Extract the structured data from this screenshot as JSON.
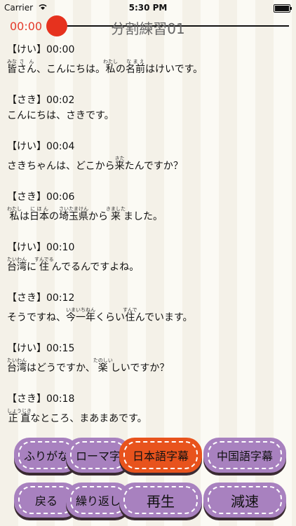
{
  "status": {
    "carrier": "Carrier",
    "time": "5:30 PM"
  },
  "player": {
    "elapsed": "00:00",
    "title": "分割練習01",
    "progress": 0
  },
  "transcript": [
    {
      "speaker": "【けい】00:00",
      "segments": [
        {
          "t": "皆",
          "r": "みな"
        },
        {
          "t": "さん",
          "r": "さん"
        },
        {
          "t": "、こんにちは。"
        },
        {
          "t": "私",
          "r": "わたし"
        },
        {
          "t": "の"
        },
        {
          "t": "名前",
          "r": "なまえ"
        },
        {
          "t": "はけいです。"
        }
      ]
    },
    {
      "speaker": "【さき】00:02",
      "segments": [
        {
          "t": "こんにちは、さきです。"
        }
      ]
    },
    {
      "speaker": "【けい】00:04",
      "segments": [
        {
          "t": "さきちゃんは、どこから"
        },
        {
          "t": "来",
          "r": "きた"
        },
        {
          "t": "たんですか？"
        }
      ]
    },
    {
      "speaker": "【さき】00:06",
      "segments": [
        {
          "t": "私",
          "r": "わたし"
        },
        {
          "t": "は"
        },
        {
          "t": "日本",
          "r": "にほん"
        },
        {
          "t": "の"
        },
        {
          "t": "埼玉県",
          "r": "さいたまけん"
        },
        {
          "t": "から"
        },
        {
          "t": "来",
          "r": "きました"
        },
        {
          "t": "ました。"
        }
      ]
    },
    {
      "speaker": "【けい】00:10",
      "segments": [
        {
          "t": "台湾",
          "r": "たいわん"
        },
        {
          "t": "に"
        },
        {
          "t": "住",
          "r": "すんでる"
        },
        {
          "t": "んでるんですよね。"
        }
      ]
    },
    {
      "speaker": "【さき】00:12",
      "segments": [
        {
          "t": "そうですね、"
        },
        {
          "t": "今一年",
          "r": "いまいちねん"
        },
        {
          "t": "くらい"
        },
        {
          "t": "住",
          "r": "すんで"
        },
        {
          "t": "んでいます。"
        }
      ]
    },
    {
      "speaker": "【けい】00:15",
      "segments": [
        {
          "t": "台湾",
          "r": "たいわん"
        },
        {
          "t": "はどうですか、"
        },
        {
          "t": "楽",
          "r": "たのしい"
        },
        {
          "t": "しいですか？"
        }
      ]
    },
    {
      "speaker": "【さき】00:18",
      "segments": [
        {
          "t": "正直",
          "r": "しょうじき"
        },
        {
          "t": "なところ、まあまあです。"
        }
      ]
    }
  ],
  "buttons": {
    "furigana_toggle": "ふりがな",
    "romaji_toggle": "ローマ字",
    "japanese_subtitle": "日本語字幕",
    "chinese_subtitle": "中国語字幕",
    "back": "戻る",
    "repeat": "繰り返し",
    "play": "再生",
    "slow": "減速"
  }
}
